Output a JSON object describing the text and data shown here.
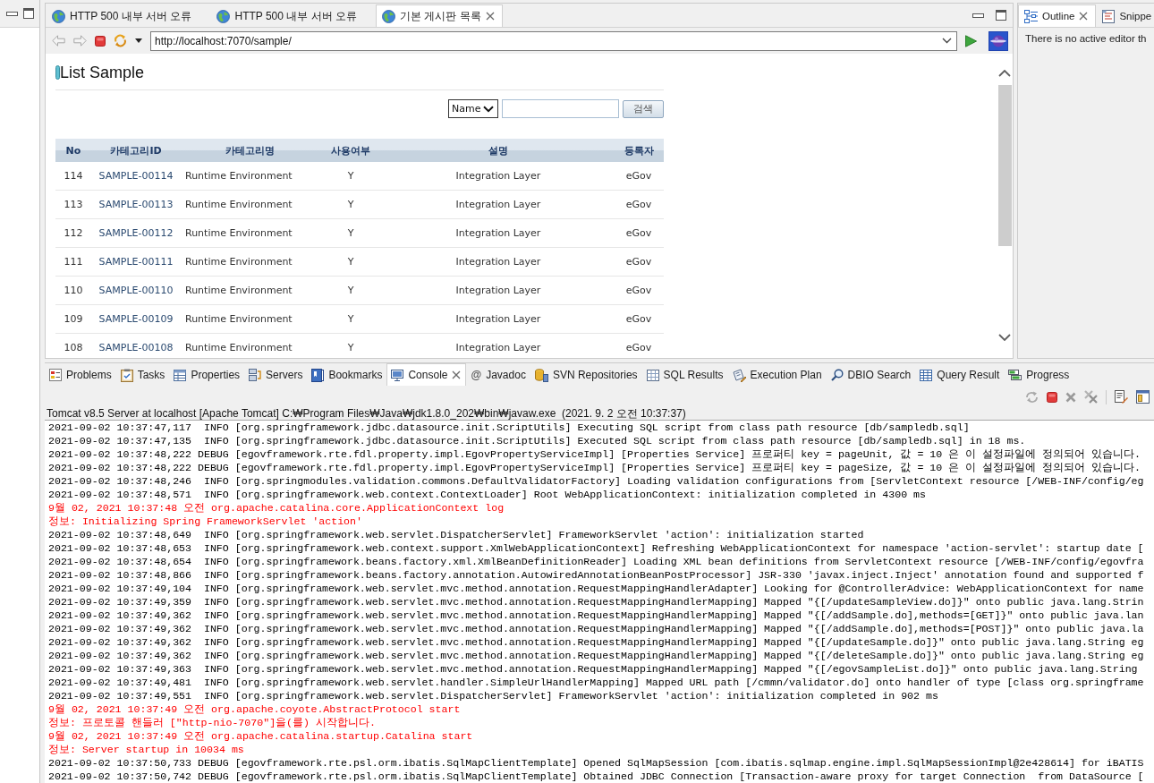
{
  "editor_tabs": [
    {
      "label": "HTTP 500 내부 서버 오류",
      "selected": false
    },
    {
      "label": "HTTP 500 내부 서버 오류",
      "selected": false
    },
    {
      "label": "기본 게시판 목록",
      "selected": true
    }
  ],
  "browser": {
    "back": {
      "disabled": true
    },
    "forward": {
      "disabled": true
    },
    "url": "http://localhost:7070/sample/"
  },
  "page": {
    "title": "List Sample",
    "search": {
      "field": "Name",
      "button": "검색"
    },
    "table": {
      "columns": [
        "No",
        "카테고리ID",
        "카테고리명",
        "사용여부",
        "설명",
        "등록자"
      ],
      "rows": [
        {
          "no": "114",
          "id": "SAMPLE-00114",
          "name": "Runtime Environment",
          "used": "Y",
          "description": "Integration Layer",
          "registrant": "eGov"
        },
        {
          "no": "113",
          "id": "SAMPLE-00113",
          "name": "Runtime Environment",
          "used": "Y",
          "description": "Integration Layer",
          "registrant": "eGov"
        },
        {
          "no": "112",
          "id": "SAMPLE-00112",
          "name": "Runtime Environment",
          "used": "Y",
          "description": "Integration Layer",
          "registrant": "eGov"
        },
        {
          "no": "111",
          "id": "SAMPLE-00111",
          "name": "Runtime Environment",
          "used": "Y",
          "description": "Integration Layer",
          "registrant": "eGov"
        },
        {
          "no": "110",
          "id": "SAMPLE-00110",
          "name": "Runtime Environment",
          "used": "Y",
          "description": "Integration Layer",
          "registrant": "eGov"
        },
        {
          "no": "109",
          "id": "SAMPLE-00109",
          "name": "Runtime Environment",
          "used": "Y",
          "description": "Integration Layer",
          "registrant": "eGov"
        },
        {
          "no": "108",
          "id": "SAMPLE-00108",
          "name": "Runtime Environment",
          "used": "Y",
          "description": "Integration Layer",
          "registrant": "eGov"
        }
      ]
    }
  },
  "outline": {
    "tabs": [
      {
        "label": "Outline",
        "selected": true
      },
      {
        "label": "Snippe",
        "selected": false
      }
    ],
    "message": "There is no active editor th"
  },
  "bottom_panel": {
    "tabs": [
      {
        "label": "Problems",
        "selected": false
      },
      {
        "label": "Tasks",
        "selected": false
      },
      {
        "label": "Properties",
        "selected": false
      },
      {
        "label": "Servers",
        "selected": false
      },
      {
        "label": "Bookmarks",
        "selected": false
      },
      {
        "label": "Console",
        "selected": true
      },
      {
        "label": "Javadoc",
        "selected": false,
        "icon_char": "@"
      },
      {
        "label": "SVN Repositories",
        "selected": false
      },
      {
        "label": "SQL Results",
        "selected": false
      },
      {
        "label": "Execution Plan",
        "selected": false
      },
      {
        "label": "DBIO Search",
        "selected": false
      },
      {
        "label": "Query Result",
        "selected": false
      },
      {
        "label": "Progress",
        "selected": false
      }
    ],
    "console": {
      "header": "Tomcat v8.5 Server at localhost [Apache Tomcat] C:₩Program Files₩Java₩jdk1.8.0_202₩bin₩javaw.exe  (2021. 9. 2 오전 10:37:37)",
      "lines": [
        {
          "kind": "stdout",
          "text": "2021-09-02 10:37:47,117  INFO [org.springframework.jdbc.datasource.init.ScriptUtils] Executing SQL script from class path resource [db/sampledb.sql]"
        },
        {
          "kind": "stdout",
          "text": "2021-09-02 10:37:47,135  INFO [org.springframework.jdbc.datasource.init.ScriptUtils] Executed SQL script from class path resource [db/sampledb.sql] in 18 ms."
        },
        {
          "kind": "stdout",
          "text": "2021-09-02 10:37:48,222 DEBUG [egovframework.rte.fdl.property.impl.EgovPropertyServiceImpl] [Properties Service] 프로퍼티 key = pageUnit, 값 = 10 은 이 설정파일에 정의되어 있습니다."
        },
        {
          "kind": "stdout",
          "text": "2021-09-02 10:37:48,222 DEBUG [egovframework.rte.fdl.property.impl.EgovPropertyServiceImpl] [Properties Service] 프로퍼티 key = pageSize, 값 = 10 은 이 설정파일에 정의되어 있습니다."
        },
        {
          "kind": "stdout",
          "text": "2021-09-02 10:37:48,246  INFO [org.springmodules.validation.commons.DefaultValidatorFactory] Loading validation configurations from [ServletContext resource [/WEB-INF/config/eg"
        },
        {
          "kind": "stdout",
          "text": "2021-09-02 10:37:48,571  INFO [org.springframework.web.context.ContextLoader] Root WebApplicationContext: initialization completed in 4300 ms"
        },
        {
          "kind": "stderr",
          "text": "9월 02, 2021 10:37:48 오전 org.apache.catalina.core.ApplicationContext log"
        },
        {
          "kind": "stderr",
          "text": "정보: Initializing Spring FrameworkServlet 'action'"
        },
        {
          "kind": "stdout",
          "text": "2021-09-02 10:37:48,649  INFO [org.springframework.web.servlet.DispatcherServlet] FrameworkServlet 'action': initialization started"
        },
        {
          "kind": "stdout",
          "text": "2021-09-02 10:37:48,653  INFO [org.springframework.web.context.support.XmlWebApplicationContext] Refreshing WebApplicationContext for namespace 'action-servlet': startup date ["
        },
        {
          "kind": "stdout",
          "text": "2021-09-02 10:37:48,654  INFO [org.springframework.beans.factory.xml.XmlBeanDefinitionReader] Loading XML bean definitions from ServletContext resource [/WEB-INF/config/egovfra"
        },
        {
          "kind": "stdout",
          "text": "2021-09-02 10:37:48,866  INFO [org.springframework.beans.factory.annotation.AutowiredAnnotationBeanPostProcessor] JSR-330 'javax.inject.Inject' annotation found and supported f"
        },
        {
          "kind": "stdout",
          "text": "2021-09-02 10:37:49,104  INFO [org.springframework.web.servlet.mvc.method.annotation.RequestMappingHandlerAdapter] Looking for @ControllerAdvice: WebApplicationContext for name"
        },
        {
          "kind": "stdout",
          "text": "2021-09-02 10:37:49,359  INFO [org.springframework.web.servlet.mvc.method.annotation.RequestMappingHandlerMapping] Mapped \"{[/updateSampleView.do]}\" onto public java.lang.Strin"
        },
        {
          "kind": "stdout",
          "text": "2021-09-02 10:37:49,362  INFO [org.springframework.web.servlet.mvc.method.annotation.RequestMappingHandlerMapping] Mapped \"{[/addSample.do],methods=[GET]}\" onto public java.lan"
        },
        {
          "kind": "stdout",
          "text": "2021-09-02 10:37:49,362  INFO [org.springframework.web.servlet.mvc.method.annotation.RequestMappingHandlerMapping] Mapped \"{[/addSample.do],methods=[POST]}\" onto public java.la"
        },
        {
          "kind": "stdout",
          "text": "2021-09-02 10:37:49,362  INFO [org.springframework.web.servlet.mvc.method.annotation.RequestMappingHandlerMapping] Mapped \"{[/updateSample.do]}\" onto public java.lang.String eg"
        },
        {
          "kind": "stdout",
          "text": "2021-09-02 10:37:49,362  INFO [org.springframework.web.servlet.mvc.method.annotation.RequestMappingHandlerMapping] Mapped \"{[/deleteSample.do]}\" onto public java.lang.String eg"
        },
        {
          "kind": "stdout",
          "text": "2021-09-02 10:37:49,363  INFO [org.springframework.web.servlet.mvc.method.annotation.RequestMappingHandlerMapping] Mapped \"{[/egovSampleList.do]}\" onto public java.lang.String"
        },
        {
          "kind": "stdout",
          "text": "2021-09-02 10:37:49,481  INFO [org.springframework.web.servlet.handler.SimpleUrlHandlerMapping] Mapped URL path [/cmmn/validator.do] onto handler of type [class org.springframe"
        },
        {
          "kind": "stdout",
          "text": "2021-09-02 10:37:49,551  INFO [org.springframework.web.servlet.DispatcherServlet] FrameworkServlet 'action': initialization completed in 902 ms"
        },
        {
          "kind": "stderr",
          "text": "9월 02, 2021 10:37:49 오전 org.apache.coyote.AbstractProtocol start"
        },
        {
          "kind": "stderr",
          "text": "정보: 프로토콜 핸들러 [\"http-nio-7070\"]을(를) 시작합니다."
        },
        {
          "kind": "stderr",
          "text": "9월 02, 2021 10:37:49 오전 org.apache.catalina.startup.Catalina start"
        },
        {
          "kind": "stderr",
          "text": "정보: Server startup in 10034 ms"
        },
        {
          "kind": "stdout",
          "text": "2021-09-02 10:37:50,733 DEBUG [egovframework.rte.psl.orm.ibatis.SqlMapClientTemplate] Opened SqlMapSession [com.ibatis.sqlmap.engine.impl.SqlMapSessionImpl@2e428614] for iBATIS"
        },
        {
          "kind": "stdout",
          "text": "2021-09-02 10:37:50,742 DEBUG [egovframework.rte.psl.orm.ibatis.SqlMapClientTemplate] Obtained JDBC Connection [Transaction-aware proxy for target Connection  from DataSource ["
        }
      ]
    }
  }
}
